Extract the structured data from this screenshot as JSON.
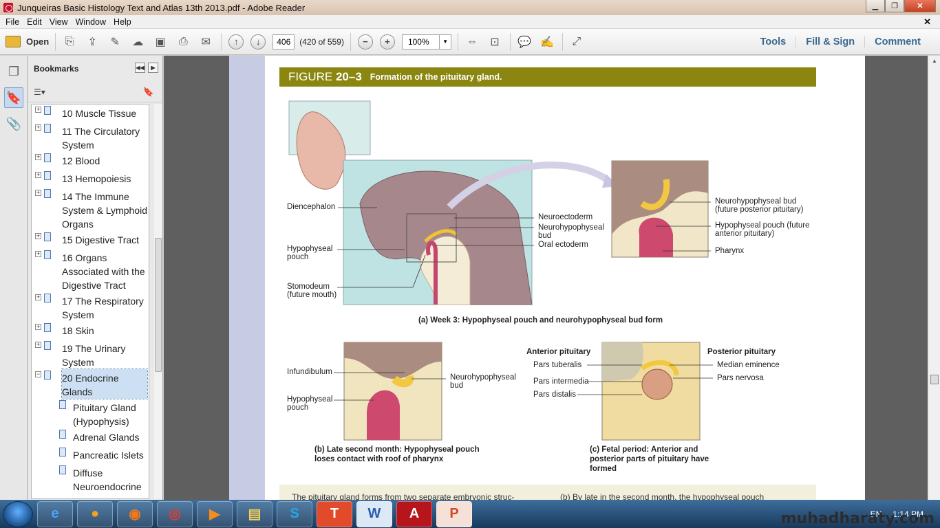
{
  "window": {
    "title": "Junqueiras Basic Histology Text and Atlas 13th 2013.pdf - Adobe Reader"
  },
  "menu": [
    "File",
    "Edit",
    "View",
    "Window",
    "Help"
  ],
  "toolbar": {
    "open_label": "Open",
    "page_number": "406",
    "page_count": "(420 of 559)",
    "zoom": "100%",
    "links": [
      "Tools",
      "Fill & Sign",
      "Comment"
    ]
  },
  "bookmarks": {
    "title": "Bookmarks",
    "items": [
      {
        "label": "10 Muscle Tissue",
        "expander": "+",
        "child": false,
        "selected": false
      },
      {
        "label": "11 The Circulatory System",
        "expander": "+",
        "child": false,
        "selected": false
      },
      {
        "label": "12 Blood",
        "expander": "+",
        "child": false,
        "selected": false
      },
      {
        "label": "13 Hemopoiesis",
        "expander": "+",
        "child": false,
        "selected": false
      },
      {
        "label": "14 The Immune System & Lymphoid Organs",
        "expander": "+",
        "child": false,
        "selected": false
      },
      {
        "label": "15 Digestive Tract",
        "expander": "+",
        "child": false,
        "selected": false
      },
      {
        "label": "16 Organs Associated with the Digestive Tract",
        "expander": "+",
        "child": false,
        "selected": false
      },
      {
        "label": "17 The Respiratory System",
        "expander": "+",
        "child": false,
        "selected": false
      },
      {
        "label": "18 Skin",
        "expander": "+",
        "child": false,
        "selected": false
      },
      {
        "label": "19 The Urinary System",
        "expander": "+",
        "child": false,
        "selected": false
      },
      {
        "label": "20 Endocrine Glands",
        "expander": "−",
        "child": false,
        "selected": true
      },
      {
        "label": "Pituitary Gland (Hypophysis)",
        "expander": "",
        "child": true,
        "selected": false
      },
      {
        "label": "Adrenal Glands",
        "expander": "",
        "child": true,
        "selected": false
      },
      {
        "label": "Pancreatic Islets",
        "expander": "",
        "child": true,
        "selected": false
      },
      {
        "label": "Diffuse Neuroendocrine",
        "expander": "",
        "child": true,
        "selected": false
      }
    ]
  },
  "figure": {
    "number_prefix": "FIGURE",
    "number": "20–3",
    "title": "Formation of the pituitary gland.",
    "labels": {
      "diencephalon": "Diencephalon",
      "hypophyseal_pouch_a": "Hypophyseal pouch",
      "stomodeum": "Stomodeum (future mouth)",
      "neuroectoderm": "Neuroectoderm",
      "neurohypophyseal_bud_a": "Neurohypophyseal bud",
      "oral_ectoderm": "Oral ectoderm",
      "nh_bud_future": "Neurohypophyseal bud (future posterior pituitary)",
      "h_pouch_future": "Hypophyseal pouch (future anterior pituitary)",
      "pharynx": "Pharynx",
      "infundibulum": "Infundibulum",
      "hypophyseal_pouch_b": "Hypophyseal pouch",
      "neurohypophyseal_bud_b": "Neurohypophyseal bud",
      "anterior_pituitary": "Anterior pituitary",
      "posterior_pituitary": "Posterior pituitary",
      "pars_tuberalis": "Pars tuberalis",
      "pars_intermedia": "Pars intermedia",
      "pars_distalis": "Pars distalis",
      "median_eminence": "Median eminence",
      "pars_nervosa": "Pars nervosa"
    },
    "captions": {
      "a": "(a) Week 3: Hypophyseal pouch and neurohypophyseal bud form",
      "b": "(b) Late second month: Hypophyseal pouch loses contact with roof of pharynx",
      "c": "(c) Fetal period: Anterior and posterior parts of pituitary have formed"
    }
  },
  "body_text": {
    "left": "The pituitary gland forms from two separate embryonic struc-",
    "right": "(b) By late in the second month, the hypophyseal pouch"
  },
  "taskbar": {
    "apps": [
      "ie-icon",
      "media-icon",
      "firefox-icon",
      "chrome-icon",
      "player-icon",
      "explorer-icon",
      "skype-icon",
      "t-app-icon",
      "word-icon",
      "acrobat-icon",
      "powerpoint-icon"
    ],
    "language": "EN",
    "time": "1:14 PM"
  },
  "watermark": "muhadharaty.com"
}
